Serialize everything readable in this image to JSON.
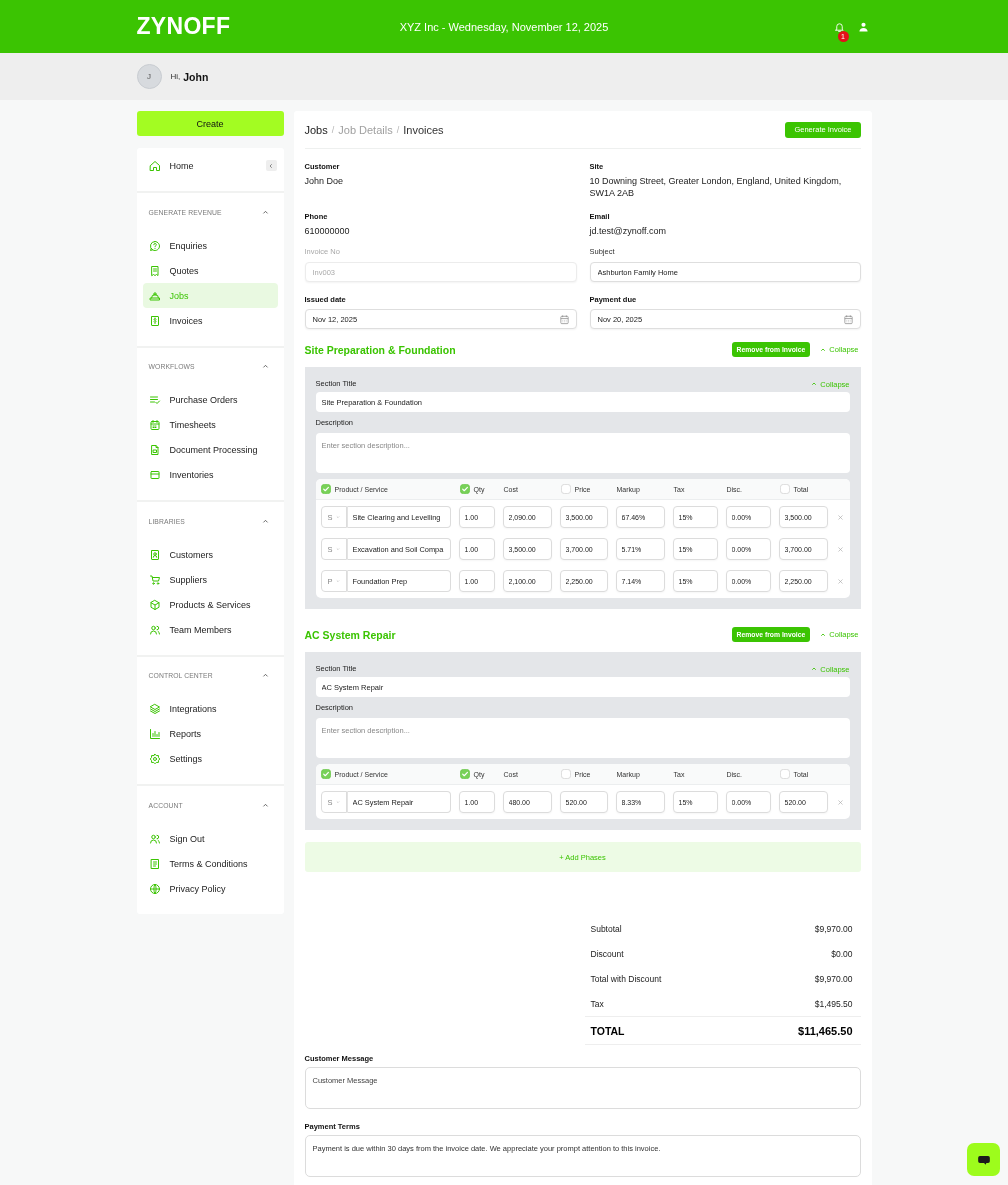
{
  "header": {
    "logo": "ZYNOFF",
    "title": "XYZ Inc - Wednesday, November 12, 2025",
    "notification_count": "1"
  },
  "greeting": {
    "avatar_initial": "J",
    "salutation": "Hi,",
    "name": "John"
  },
  "sidebar": {
    "create_button": "Create",
    "home": {
      "label": "Home",
      "selected": false
    },
    "sections": [
      {
        "title": "GENERATE REVENUE",
        "expanded": true,
        "items": [
          {
            "label": "Enquiries",
            "selected": false
          },
          {
            "label": "Quotes",
            "selected": false
          },
          {
            "label": "Jobs",
            "selected": true
          },
          {
            "label": "Invoices",
            "selected": false
          }
        ]
      },
      {
        "title": "WORKFLOWS",
        "expanded": true,
        "items": [
          {
            "label": "Purchase Orders",
            "selected": false
          },
          {
            "label": "Timesheets",
            "selected": false
          },
          {
            "label": "Document Processing",
            "selected": false
          },
          {
            "label": "Inventories",
            "selected": false
          }
        ]
      },
      {
        "title": "LIBRARIES",
        "expanded": true,
        "items": [
          {
            "label": "Customers",
            "selected": false
          },
          {
            "label": "Suppliers",
            "selected": false
          },
          {
            "label": "Products & Services",
            "selected": false
          },
          {
            "label": "Team Members",
            "selected": false
          }
        ]
      },
      {
        "title": "CONTROL CENTER",
        "expanded": true,
        "items": [
          {
            "label": "Integrations",
            "selected": false
          },
          {
            "label": "Reports",
            "selected": false
          },
          {
            "label": "Settings",
            "selected": false
          }
        ]
      },
      {
        "title": "ACCOUNT",
        "expanded": true,
        "items": [
          {
            "label": "Sign Out",
            "selected": false
          },
          {
            "label": "Terms & Conditions",
            "selected": false
          },
          {
            "label": "Privacy Policy",
            "selected": false
          }
        ]
      }
    ]
  },
  "breadcrumb": {
    "separator": "/",
    "items": [
      {
        "label": "Jobs"
      },
      {
        "label": "Job Details"
      },
      {
        "label": "Invoices"
      }
    ]
  },
  "generate_button": "Generate Invoice",
  "details": [
    {
      "label": "Customer",
      "value": "John Doe"
    },
    {
      "label": "Site",
      "value": "10 Downing Street, Greater London, England, United Kingdom, SW1A 2AB"
    },
    {
      "label": "Phone",
      "value": "610000000"
    },
    {
      "label": "Email",
      "value": "jd.test@zynoff.com"
    }
  ],
  "fields": [
    {
      "label": "Invoice No",
      "kind": "text",
      "value": "Inv003",
      "disabled": true
    },
    {
      "label": "Subject",
      "kind": "text",
      "value": "Ashburton Family Home",
      "disabled": false
    },
    {
      "label": "Issued date",
      "kind": "date",
      "value": "Nov 12, 2025",
      "disabled": false
    },
    {
      "label": "Payment due",
      "kind": "date",
      "value": "Nov 20, 2025",
      "disabled": false
    }
  ],
  "phases": [
    {
      "title": "Site Preparation & Foundation",
      "remove_button": "Remove from Invoice",
      "collapse_link": "Collapse",
      "expanded": true,
      "section_title": {
        "label": "Section Title",
        "value": "Site Preparation & Foundation",
        "collapse_link": "Collapse"
      },
      "description": {
        "label": "Description",
        "placeholder": "Enter section description..."
      },
      "columns": [
        {
          "label": "Product / Service",
          "kind": "checkbox",
          "checked": true
        },
        {
          "label": "Qty",
          "kind": "checkbox",
          "checked": true
        },
        {
          "label": "Cost",
          "kind": "plain"
        },
        {
          "label": "Price",
          "kind": "checkbox",
          "checked": false
        },
        {
          "label": "Markup",
          "kind": "plain"
        },
        {
          "label": "Tax",
          "kind": "plain"
        },
        {
          "label": "Disc.",
          "kind": "plain"
        },
        {
          "label": "Total",
          "kind": "checkbox",
          "checked": false
        }
      ],
      "rows": [
        {
          "type": "S",
          "name": "Site Clearing and Levelling",
          "qty": "1.00",
          "cost": "2,090.00",
          "price": "3,500.00",
          "markup": "67.46%",
          "tax": "15%",
          "discount": "0.00%",
          "total": "3,500.00"
        },
        {
          "type": "S",
          "name": "Excavation and Soil Compa",
          "qty": "1.00",
          "cost": "3,500.00",
          "price": "3,700.00",
          "markup": "5.71%",
          "tax": "15%",
          "discount": "0.00%",
          "total": "3,700.00"
        },
        {
          "type": "P",
          "name": "Foundation Prep",
          "qty": "1.00",
          "cost": "2,100.00",
          "price": "2,250.00",
          "markup": "7.14%",
          "tax": "15%",
          "discount": "0.00%",
          "total": "2,250.00"
        }
      ]
    },
    {
      "title": "AC System Repair",
      "remove_button": "Remove from Invoice",
      "collapse_link": "Collapse",
      "expanded": true,
      "section_title": {
        "label": "Section Title",
        "value": "AC System Repair",
        "collapse_link": "Collapse"
      },
      "description": {
        "label": "Description",
        "placeholder": "Enter section description..."
      },
      "columns": [
        {
          "label": "Product / Service",
          "kind": "checkbox",
          "checked": true
        },
        {
          "label": "Qty",
          "kind": "checkbox",
          "checked": true
        },
        {
          "label": "Cost",
          "kind": "plain"
        },
        {
          "label": "Price",
          "kind": "checkbox",
          "checked": false
        },
        {
          "label": "Markup",
          "kind": "plain"
        },
        {
          "label": "Tax",
          "kind": "plain"
        },
        {
          "label": "Disc.",
          "kind": "plain"
        },
        {
          "label": "Total",
          "kind": "checkbox",
          "checked": false
        }
      ],
      "rows": [
        {
          "type": "S",
          "name": "AC System Repair",
          "qty": "1.00",
          "cost": "480.00",
          "price": "520.00",
          "markup": "8.33%",
          "tax": "15%",
          "discount": "0.00%",
          "total": "520.00"
        }
      ]
    }
  ],
  "add_phases_button": "+ Add Phases",
  "totals": [
    {
      "label": "Subtotal",
      "value": "$9,970.00",
      "kind": "line"
    },
    {
      "label": "Discount",
      "value": "$0.00",
      "kind": "line"
    },
    {
      "label": "Total with Discount",
      "value": "$9,970.00",
      "kind": "line"
    },
    {
      "label": "Tax",
      "value": "$1,495.50",
      "kind": "line"
    },
    {
      "label": "TOTAL",
      "value": "$11,465.50",
      "kind": "grand"
    }
  ],
  "customer_message": {
    "label": "Customer Message",
    "placeholder": "Customer Message"
  },
  "payment_terms": {
    "label": "Payment Terms",
    "value": "Payment is due within 30 days from the invoice date. We appreciate your prompt attention to this invoice."
  }
}
